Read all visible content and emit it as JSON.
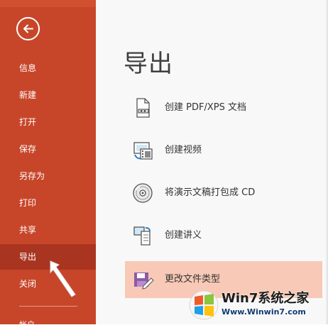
{
  "sidebar": {
    "back_icon": "back-arrow-icon",
    "items": [
      {
        "label": "信息"
      },
      {
        "label": "新建"
      },
      {
        "label": "打开"
      },
      {
        "label": "保存"
      },
      {
        "label": "另存为"
      },
      {
        "label": "打印"
      },
      {
        "label": "共享"
      },
      {
        "label": "导出",
        "active": true
      },
      {
        "label": "关闭"
      }
    ],
    "bottom_partial_label": "帐户"
  },
  "main": {
    "title": "导出",
    "options": [
      {
        "label": "创建 PDF/XPS 文档",
        "icon": "pdf-document-icon"
      },
      {
        "label": "创建视频",
        "icon": "video-icon"
      },
      {
        "label": "将演示文稿打包成 CD",
        "icon": "cd-icon"
      },
      {
        "label": "创建讲义",
        "icon": "handout-icon"
      },
      {
        "label": "更改文件类型",
        "icon": "file-type-icon",
        "selected": true
      }
    ]
  },
  "watermark": {
    "brand": "Win7系统之家",
    "url": "Www.Winwin7.com"
  },
  "colors": {
    "sidebar": "#c7462a",
    "active_item": "#a93520",
    "selected_option": "#f8c9b6",
    "text": "#333333"
  }
}
